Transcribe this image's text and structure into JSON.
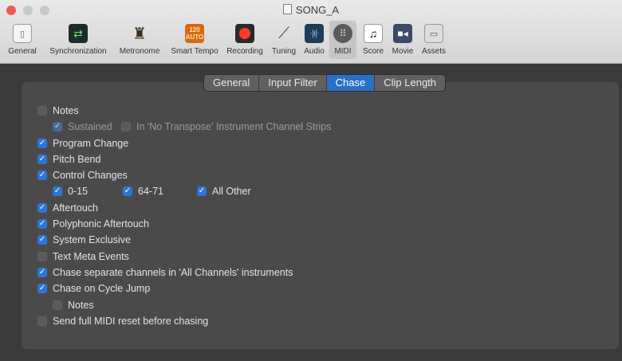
{
  "window": {
    "title": "SONG_A"
  },
  "toolbar": [
    {
      "label": "General",
      "icon": "general-icon",
      "glyph": "▯",
      "active": false
    },
    {
      "label": "Synchronization",
      "icon": "synchronization-icon",
      "glyph": "⇄",
      "active": false
    },
    {
      "label": "Metronome",
      "icon": "metronome-icon",
      "glyph": "♜",
      "active": false
    },
    {
      "label": "Smart Tempo",
      "icon": "smart-tempo-icon",
      "glyph": "120",
      "glyph2": "AUTO",
      "active": false
    },
    {
      "label": "Recording",
      "icon": "record-icon",
      "glyph": "",
      "active": false
    },
    {
      "label": "Tuning",
      "icon": "tuning-fork-icon",
      "glyph": "⟋",
      "active": false
    },
    {
      "label": "Audio",
      "icon": "audio-waveform-icon",
      "glyph": "·|ı|·",
      "active": false
    },
    {
      "label": "MIDI",
      "icon": "midi-port-icon",
      "glyph": "⠿",
      "active": true
    },
    {
      "label": "Score",
      "icon": "score-note-icon",
      "glyph": "♫",
      "active": false
    },
    {
      "label": "Movie",
      "icon": "movie-camera-icon",
      "glyph": "■◂",
      "active": false
    },
    {
      "label": "Assets",
      "icon": "assets-briefcase-icon",
      "glyph": "▭",
      "active": false
    }
  ],
  "tabs": [
    {
      "label": "General",
      "active": false
    },
    {
      "label": "Input Filter",
      "active": false
    },
    {
      "label": "Chase",
      "active": true
    },
    {
      "label": "Clip Length",
      "active": false
    }
  ],
  "options": [
    {
      "label": "Notes",
      "checked": false,
      "enabled": true
    },
    {
      "label": "Sustained",
      "checked": true,
      "enabled": false
    },
    {
      "label": "In 'No Transpose' Instrument Channel Strips",
      "checked": false,
      "enabled": false
    },
    {
      "label": "Program Change",
      "checked": true,
      "enabled": true
    },
    {
      "label": "Pitch Bend",
      "checked": true,
      "enabled": true
    },
    {
      "label": "Control Changes",
      "checked": true,
      "enabled": true
    },
    {
      "label": "0-15",
      "checked": true,
      "enabled": true
    },
    {
      "label": "64-71",
      "checked": true,
      "enabled": true
    },
    {
      "label": "All Other",
      "checked": true,
      "enabled": true
    },
    {
      "label": "Aftertouch",
      "checked": true,
      "enabled": true
    },
    {
      "label": "Polyphonic Aftertouch",
      "checked": true,
      "enabled": true
    },
    {
      "label": "System Exclusive",
      "checked": true,
      "enabled": true
    },
    {
      "label": "Text Meta Events",
      "checked": false,
      "enabled": true
    },
    {
      "label": "Chase separate channels in 'All Channels' instruments",
      "checked": true,
      "enabled": true
    },
    {
      "label": "Chase on Cycle Jump",
      "checked": true,
      "enabled": true
    },
    {
      "label": "Notes",
      "checked": false,
      "enabled": true
    },
    {
      "label": "Send full MIDI reset before chasing",
      "checked": false,
      "enabled": true
    }
  ],
  "colors": {
    "accent": "#2c76d6",
    "panel": "#4a4a4a",
    "window": "#3a3a3a",
    "record": "#ff3b30"
  }
}
